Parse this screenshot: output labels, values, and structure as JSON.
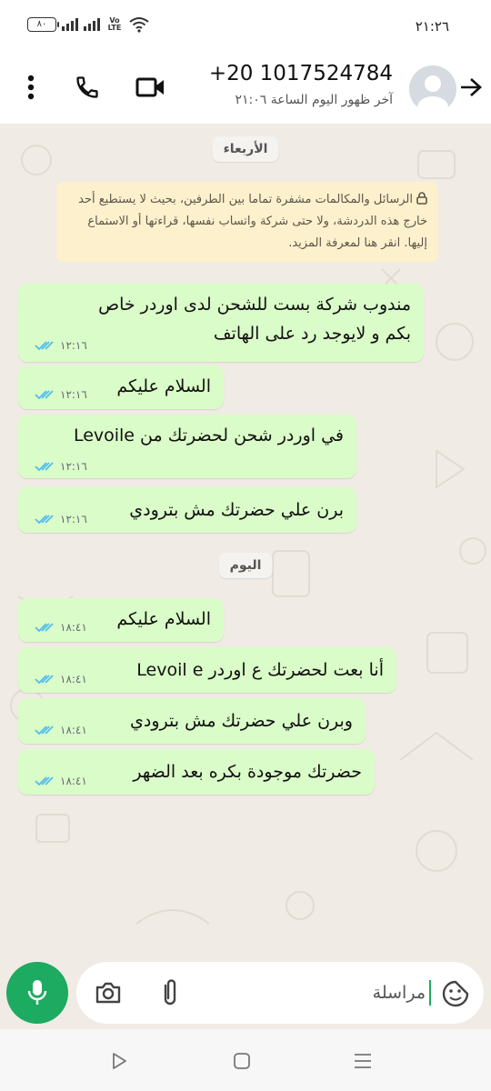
{
  "status_bar": {
    "time": "٢١:٢٦",
    "battery": "٨٠",
    "network_label": "Vo LTE"
  },
  "header": {
    "contact_name": "+20 1017524784",
    "last_seen": "آخر ظهور اليوم الساعة ٢١:٠٦",
    "icons": [
      "back-arrow-icon",
      "avatar",
      "video-call-icon",
      "voice-call-icon",
      "more-options-icon"
    ]
  },
  "chat": {
    "date_wednesday": "الأربعاء",
    "date_today": "اليوم",
    "encryption_notice": "الرسائل والمكالمات مشفرة تماما بين الطرفين، بحيث لا يستطيع أحد خارج هذه الدردشة، ولا حتى شركة واتساب نفسها، قراءتها أو الاستماع إليها. انقر هنا لمعرفة المزيد.",
    "messages": [
      {
        "line1": "مندوب شركة بست للشحن لدى اوردر خاص",
        "line2": "بكم و لايوجد رد على الهاتف",
        "time": "١٢:١٦",
        "status": "read"
      },
      {
        "text": "السلام عليكم",
        "time": "١٢:١٦",
        "status": "read"
      },
      {
        "text": "في اوردر شحن لحضرتك من Levoile",
        "time": "١٢:١٦",
        "status": "read"
      },
      {
        "text": "برن علي حضرتك مش بترودي",
        "time": "١٢:١٦",
        "status": "read"
      },
      {
        "text": "السلام عليكم",
        "time": "١٨:٤١",
        "status": "read"
      },
      {
        "text": "أنا بعت لحضرتك ع اوردر Levoil e",
        "time": "١٨:٤١",
        "status": "read"
      },
      {
        "text": "وبرن علي حضرتك مش بترودي",
        "time": "١٨:٤١",
        "status": "read"
      },
      {
        "text": "حضرتك موجودة بكره بعد الضهر",
        "time": "١٨:٤١",
        "status": "read"
      }
    ]
  },
  "composer": {
    "placeholder": "مراسلة",
    "icons": [
      "sticker-icon",
      "attach-icon",
      "camera-icon",
      "mic-icon"
    ]
  },
  "nav": {
    "icons": [
      "recents-icon",
      "home-icon",
      "back-icon"
    ]
  },
  "colors": {
    "bubble": "#dafcc8",
    "accent": "#1daa61",
    "ticks": "#53bdeb",
    "notice_bg": "#fdf0cd",
    "chat_bg": "#f0ebe4"
  }
}
